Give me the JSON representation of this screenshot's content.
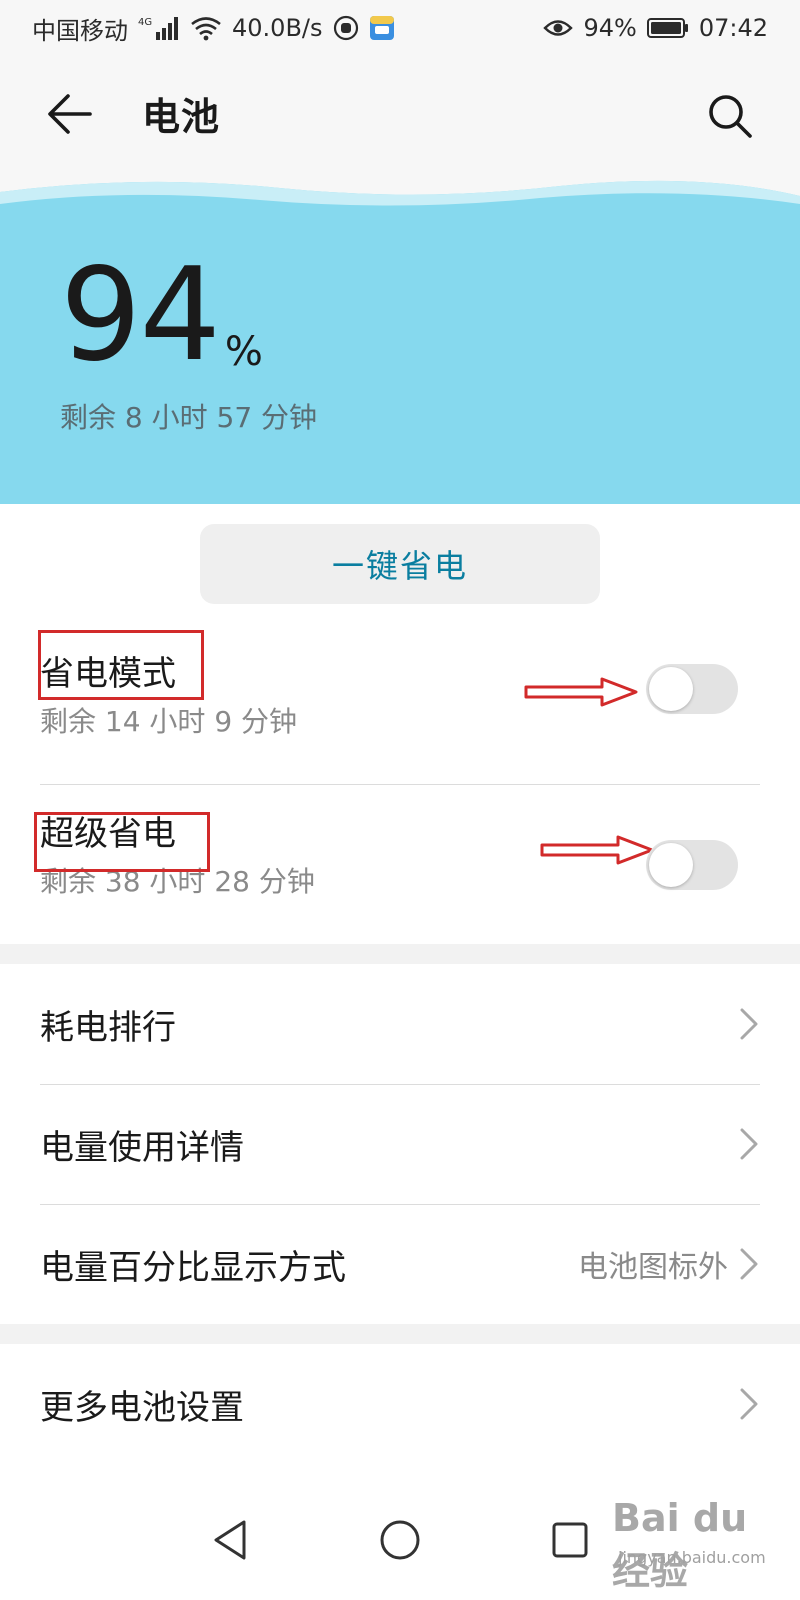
{
  "status_bar": {
    "carrier": "中国移动",
    "network_type": "4G",
    "speed": "40.0B/s",
    "battery_percent": "94%",
    "time": "07:42"
  },
  "app_bar": {
    "title": "电池"
  },
  "hero": {
    "percent_value": "94",
    "percent_unit": "%",
    "remaining": "剩余 8 小时 57 分钟",
    "level": 0.94
  },
  "one_key_button": {
    "label": "一键省电"
  },
  "power_saving_mode": {
    "title": "省电模式",
    "subtitle": "剩余 14 小时 9 分钟",
    "enabled": false
  },
  "ultra_power_saving": {
    "title": "超级省电",
    "subtitle": "剩余 38 小时 28 分钟",
    "enabled": false
  },
  "menu": {
    "items": [
      {
        "label": "耗电排行",
        "value": ""
      },
      {
        "label": "电量使用详情",
        "value": ""
      },
      {
        "label": "电量百分比显示方式",
        "value": "电池图标外"
      },
      {
        "label": "更多电池设置",
        "value": ""
      }
    ]
  },
  "watermark": {
    "main": "Bai du 经验",
    "sub": "jingyan.baidu.com"
  },
  "colors": {
    "hero_bg": "#86d9ee",
    "accent": "#0a7ea0",
    "annotation": "#d22a2a"
  }
}
